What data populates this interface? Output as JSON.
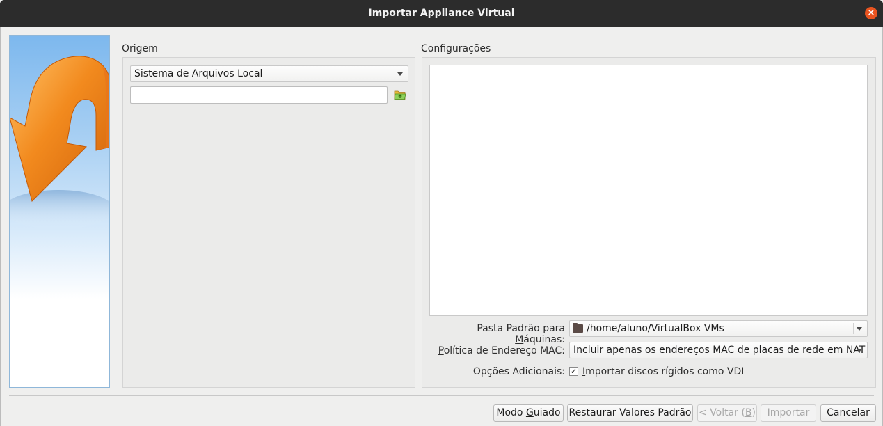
{
  "window": {
    "title": "Importar Appliance Virtual"
  },
  "source": {
    "group_title": "Origem",
    "source_value": "Sistema de Arquivos Local",
    "file_path_value": ""
  },
  "settings": {
    "group_title": "Configurações",
    "machine_folder": {
      "label_prefix": "Pasta Padrão para ",
      "label_mnemonic": "M",
      "label_suffix": "áquinas:",
      "value": "/home/aluno/VirtualBox VMs"
    },
    "mac_policy": {
      "label_mnemonic": "P",
      "label_suffix": "olítica de Endereço MAC:",
      "value": "Incluir apenas os endereços MAC de placas de rede em NAT"
    },
    "additional_options": {
      "label": "Opções Adicionais:",
      "checkbox_checked": true,
      "checkbox_mark": "✓",
      "checkbox_mnemonic": "I",
      "checkbox_label_rest": "mportar discos rígidos como VDI"
    }
  },
  "buttons": {
    "guided_mode_prefix": "Modo ",
    "guided_mode_mnemonic": "G",
    "guided_mode_suffix": "uiado",
    "restore_defaults": "Restaurar Valores Padrão",
    "back_prefix": "< Voltar (",
    "back_mnemonic": "B",
    "back_suffix": ")",
    "import": "Importar",
    "cancel": "Cancelar"
  },
  "colors": {
    "titlebar": "#2c2c2c",
    "close_button": "#e95420",
    "wizard_arrow": "#f28a1e"
  }
}
